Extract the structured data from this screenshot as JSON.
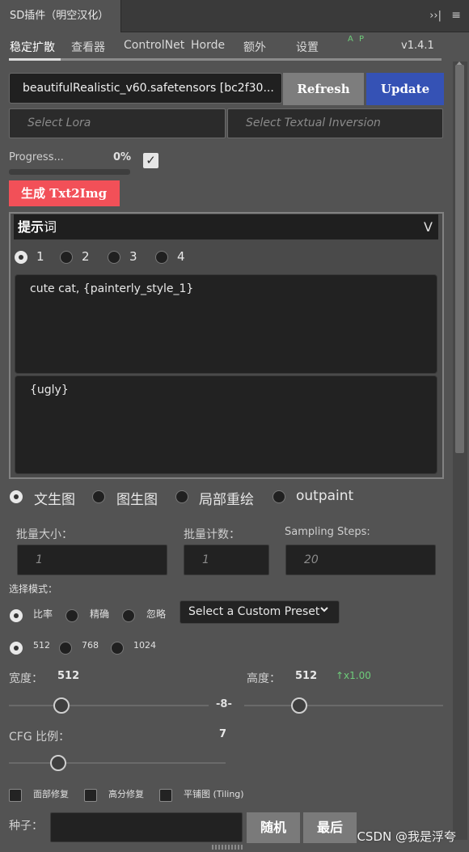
{
  "title": {
    "tab_label": "SD插件（明空汉化）",
    "collapse_glyph": "››|",
    "menu_glyph": "≡"
  },
  "tabs": [
    {
      "label": "稳定扩散",
      "active": true
    },
    {
      "label": "查看器"
    },
    {
      "label": "ControlNet"
    },
    {
      "label": "Horde"
    },
    {
      "label": "额外"
    },
    {
      "label": "设置"
    }
  ],
  "ap_label": "A P",
  "version": "v1.4.1",
  "model": {
    "value": "beautifulRealistic_v60.safetensors [bc2f30...",
    "refresh_label": "Refresh",
    "update_label": "Update",
    "lora_placeholder": "Select Lora",
    "ti_placeholder": "Select Textual Inversion"
  },
  "progress": {
    "label": "Progress...",
    "percent_text": "0%",
    "fraction": 0.0,
    "checkbox_checked": true
  },
  "generate_label": "生成 Txt2Img",
  "prompt": {
    "header_bold": "提示",
    "header_rest": "词",
    "chevron": "V",
    "slots": [
      "1",
      "2",
      "3",
      "4"
    ],
    "selected_slot": "1",
    "positive": "cute cat, {painterly_style_1}",
    "negative": "{ugly}"
  },
  "modes": {
    "options": [
      "文生图",
      "图生图",
      "局部重绘",
      "outpaint"
    ],
    "selected": "文生图"
  },
  "batch": {
    "size_label": "批量大小：",
    "size_value": "1",
    "count_label": "批量计数：",
    "count_value": "1",
    "steps_label": "Sampling Steps:",
    "steps_value": "20"
  },
  "select_mode": {
    "label": "选择模式：",
    "options": [
      "比率",
      "精确",
      "忽略"
    ],
    "selected": "比率",
    "preset_label": "Select a Custom Preset"
  },
  "resolution": {
    "options": [
      "512",
      "768",
      "1024"
    ],
    "selected": "512"
  },
  "size": {
    "width_label": "宽度：",
    "width_value": "512",
    "height_label": "高度：",
    "height_value": "512",
    "ratio_text": "↑x1.00",
    "link_glyph": "-8-"
  },
  "cfg": {
    "label": "CFG 比例：",
    "value": "7"
  },
  "options": {
    "face_fix": "面部修复",
    "hires_fix": "高分修复",
    "tiling": "平铺图 (Tiling)"
  },
  "seed": {
    "label": "种子：",
    "value": "",
    "random_label": "随机",
    "last_label": "最后"
  },
  "watermark": "CSDN @我是浮夸",
  "colors": {
    "panel_bg": "#535353",
    "update_blue": "#3552b5",
    "generate_red": "#f25058",
    "ap_green": "#6ecc7a"
  }
}
